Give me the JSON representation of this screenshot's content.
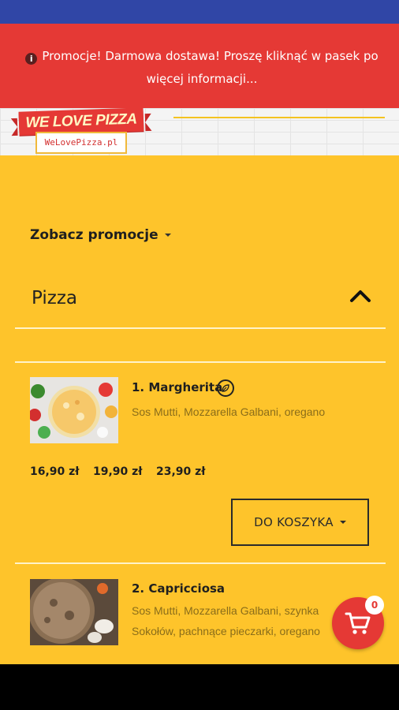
{
  "promo_banner": {
    "text": "Promocje! Darmowa dostawa! Proszę kliknąć w pasek po więcej informacji..."
  },
  "logo": {
    "brand": "WE LOVE PIZZA",
    "site": "WeLovePizza.pl"
  },
  "promotions_toggle": "Zobacz promocje",
  "section": {
    "title": "Pizza"
  },
  "items": [
    {
      "name": "1. Margherita",
      "description": "Sos Mutti, Mozzarella Galbani, oregano",
      "badge_icon": "leaf-icon",
      "prices": [
        "16,90 zł",
        "19,90 zł",
        "23,90 zł"
      ],
      "add_to_cart": "DO KOSZYKA"
    },
    {
      "name": "2. Capricciosa",
      "description": "Sos Mutti, Mozzarella Galbani, szynka Sokołów, pachnące pieczarki, oregano"
    }
  ],
  "cart": {
    "count": "0"
  },
  "colors": {
    "status_bar": "#3046a6",
    "banner": "#e53935",
    "background": "#fec42b"
  }
}
